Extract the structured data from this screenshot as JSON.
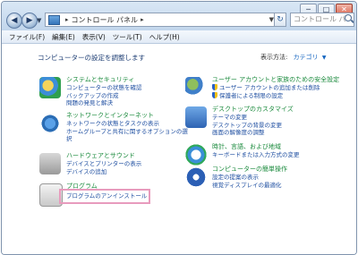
{
  "window": {
    "breadcrumb": "コントロール パネル",
    "search_placeholder": "コントロール パ",
    "buttons": {
      "minimize": "─",
      "maximize": "□",
      "close": "✕"
    },
    "nav": {
      "back": "◀",
      "forward": "▶",
      "refresh": "↻"
    }
  },
  "menu": [
    "ファイル(F)",
    "編集(E)",
    "表示(V)",
    "ツール(T)",
    "ヘルプ(H)"
  ],
  "heading": "コンピューターの設定を調整します",
  "view_by": {
    "label": "表示方法:",
    "value": "カテゴリ",
    "caret": "▼"
  },
  "categories": [
    {
      "title": "システムとセキュリティ",
      "icon": "shield-monitor-icon",
      "links": [
        "コンピューターの状態を確認",
        "バックアップの作成",
        "問題の発見と解決"
      ]
    },
    {
      "title": "ネットワークとインターネット",
      "icon": "network-globe-icon",
      "links": [
        "ネットワークの状態とタスクの表示",
        "ホームグループと共有に関するオプションの選択"
      ]
    },
    {
      "title": "ハードウェアとサウンド",
      "icon": "printer-speaker-icon",
      "links": [
        "デバイスとプリンターの表示",
        "デバイスの追加"
      ]
    },
    {
      "title": "プログラム",
      "icon": "program-box-icon",
      "links": [
        "プログラムのアンインストール"
      ]
    },
    {
      "title": "ユーザー アカウントと家族のための安全設定",
      "icon": "users-icon",
      "links": [
        "ユーザー アカウントの追加または削除",
        "保護者による制限の設定"
      ]
    },
    {
      "title": "デスクトップのカスタマイズ",
      "icon": "desktop-appearance-icon",
      "links": [
        "テーマの変更",
        "デスクトップの背景の変更",
        "画面の解像度の調整"
      ]
    },
    {
      "title": "時計、言語、および地域",
      "icon": "clock-globe-icon",
      "links": [
        "キーボードまたは入力方式の変更"
      ]
    },
    {
      "title": "コンピューターの簡単操作",
      "icon": "ease-of-access-icon",
      "links": [
        "設定の提案の表示",
        "視覚ディスプレイの最適化"
      ]
    }
  ],
  "colors": {
    "category_title": "#1a8a3c",
    "link": "#1f4fa1",
    "highlight": "#e89bbd"
  }
}
